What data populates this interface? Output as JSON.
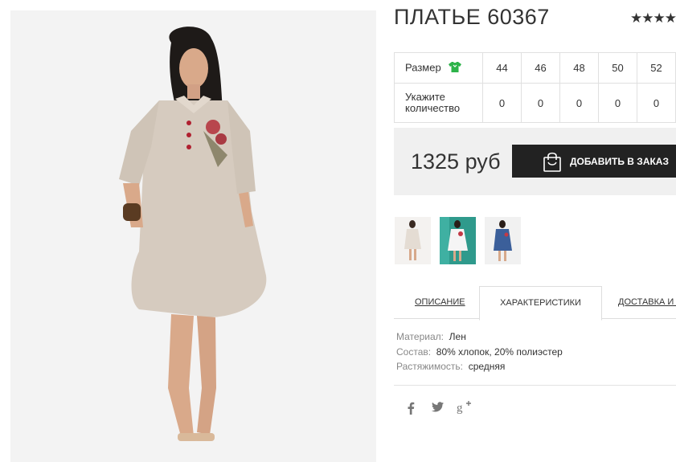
{
  "product": {
    "title": "ПЛАТЬЕ 60367",
    "rating_stars": "★★★★"
  },
  "sizes": {
    "size_label": "Размер",
    "values": [
      "44",
      "46",
      "48",
      "50",
      "52"
    ],
    "qty_label": "Укажите количество",
    "quantities": [
      "0",
      "0",
      "0",
      "0",
      "0"
    ]
  },
  "purchase": {
    "price": "1325 руб",
    "add_button": "ДОБАВИТЬ В ЗАКАЗ"
  },
  "tabs": [
    {
      "label": "ОПИСАНИЕ",
      "active": false
    },
    {
      "label": "ХАРАКТЕРИСТИКИ",
      "active": true
    },
    {
      "label": "ДОСТАВКА И ОПЛАТА",
      "active": false
    }
  ],
  "specs": [
    {
      "key": "Материал:",
      "value": "Лен"
    },
    {
      "key": "Состав:",
      "value": "80% хлопок, 20% полиэстер"
    },
    {
      "key": "Растяжимость:",
      "value": "средняя"
    }
  ],
  "social": [
    "facebook-icon",
    "twitter-icon",
    "google-plus-icon"
  ],
  "colors": {
    "dark": "#222222",
    "price_box_bg": "#f0f0f0",
    "size_icon": "#2db34a",
    "dress_beige": "#d6cbbf"
  }
}
